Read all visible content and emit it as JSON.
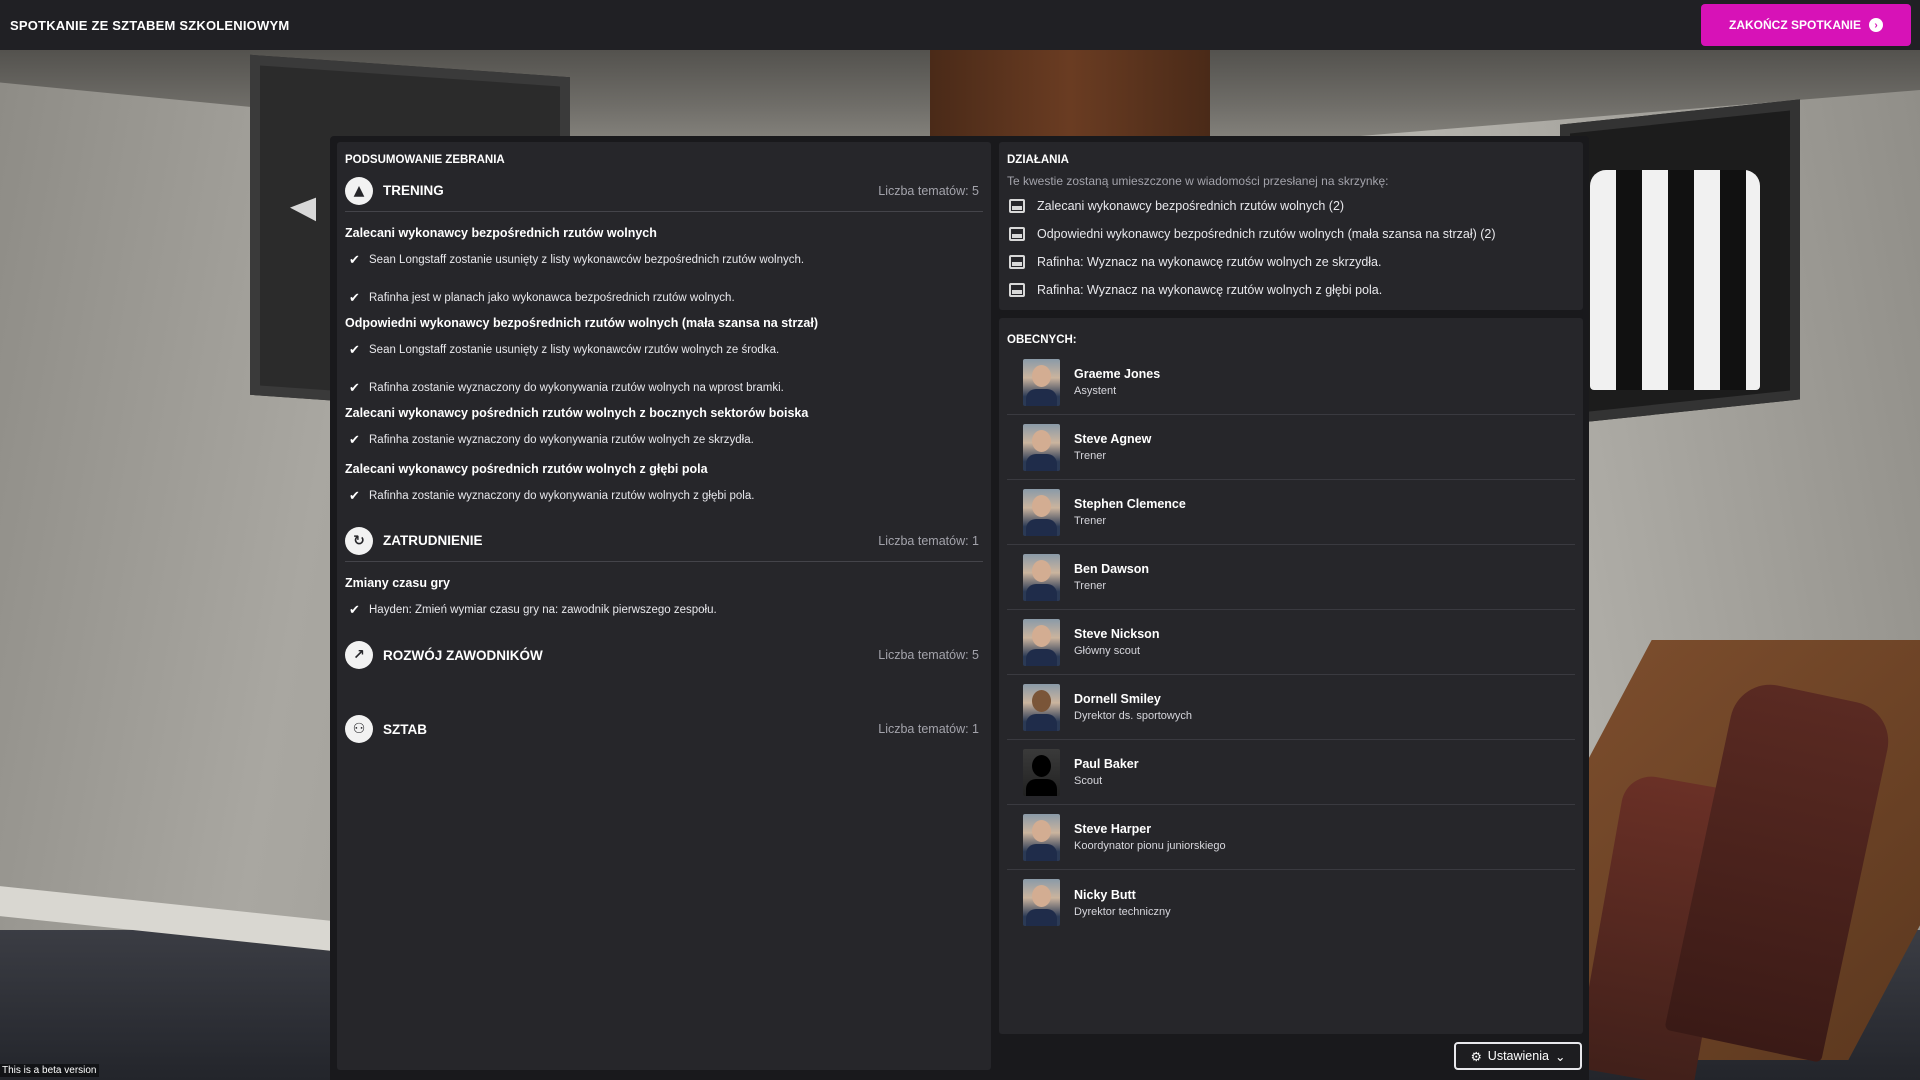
{
  "header": {
    "title": "SPOTKANIE ZE SZTABEM SZKOLENIOWYM",
    "end_button": "ZAKOŃCZ SPOTKANIE"
  },
  "summary": {
    "label": "PODSUMOWANIE ZEBRANIA",
    "categories": [
      {
        "name": "TRENING",
        "count": "Liczba tematów: 5",
        "icon": "cone-icon",
        "topics": [
          {
            "title": "Zalecani wykonawcy bezpośrednich rzutów wolnych",
            "items": [
              "Sean Longstaff zostanie usunięty z listy wykonawców bezpośrednich rzutów wolnych.",
              "Rafinha jest w planach jako wykonawca bezpośrednich rzutów wolnych."
            ]
          },
          {
            "title": "Odpowiedni wykonawcy bezpośrednich rzutów wolnych (mała szansa na strzał)",
            "items": [
              "Sean Longstaff zostanie usunięty z listy wykonawców rzutów wolnych ze środka.",
              "Rafinha zostanie wyznaczony do wykonywania rzutów wolnych na wprost bramki."
            ]
          },
          {
            "title": "Zalecani wykonawcy pośrednich rzutów wolnych z bocznych sektorów boiska",
            "items": [
              "Rafinha zostanie wyznaczony do wykonywania rzutów wolnych ze skrzydła."
            ]
          },
          {
            "title": "Zalecani wykonawcy pośrednich rzutów wolnych z głębi pola",
            "items": [
              "Rafinha zostanie wyznaczony do wykonywania rzutów wolnych z głębi pola."
            ]
          }
        ]
      },
      {
        "name": "ZATRUDNIENIE",
        "count": "Liczba tematów: 1",
        "icon": "refresh-icon",
        "topics": [
          {
            "title": "Zmiany czasu gry",
            "items": [
              "Hayden: Zmień wymiar czasu gry na: zawodnik pierwszego zespołu."
            ]
          }
        ]
      },
      {
        "name": "ROZWÓJ ZAWODNIKÓW",
        "count": "Liczba tematów: 5",
        "icon": "growth-icon",
        "topics": []
      },
      {
        "name": "SZTAB",
        "count": "Liczba tematów: 1",
        "icon": "staff-icon",
        "topics": []
      }
    ]
  },
  "actions": {
    "label": "DZIAŁANIA",
    "description": "Te kwestie zostaną umieszczone w wiadomości przesłanej na skrzynkę:",
    "items": [
      "Zalecani wykonawcy bezpośrednich rzutów wolnych (2)",
      "Odpowiedni wykonawcy bezpośrednich rzutów wolnych (mała szansa na strzał) (2)",
      "Rafinha: Wyznacz na wykonawcę rzutów wolnych ze skrzydła.",
      "Rafinha: Wyznacz na wykonawcę rzutów wolnych z głębi pola."
    ]
  },
  "attendees": {
    "label": "OBECNYCH:",
    "people": [
      {
        "name": "Graeme Jones",
        "role": "Asystent"
      },
      {
        "name": "Steve Agnew",
        "role": "Trener"
      },
      {
        "name": "Stephen Clemence",
        "role": "Trener"
      },
      {
        "name": "Ben Dawson",
        "role": "Trener"
      },
      {
        "name": "Steve Nickson",
        "role": "Główny scout"
      },
      {
        "name": "Dornell Smiley",
        "role": "Dyrektor ds. sportowych"
      },
      {
        "name": "Paul Baker",
        "role": "Scout"
      },
      {
        "name": "Steve Harper",
        "role": "Koordynator pionu juniorskiego"
      },
      {
        "name": "Nicky Butt",
        "role": "Dyrektor techniczny"
      }
    ]
  },
  "footer": {
    "settings": "Ustawienia",
    "beta": "This is a beta version"
  },
  "colors": {
    "accent": "#d712b7",
    "panel": "#26262a",
    "topbar": "#202024"
  }
}
